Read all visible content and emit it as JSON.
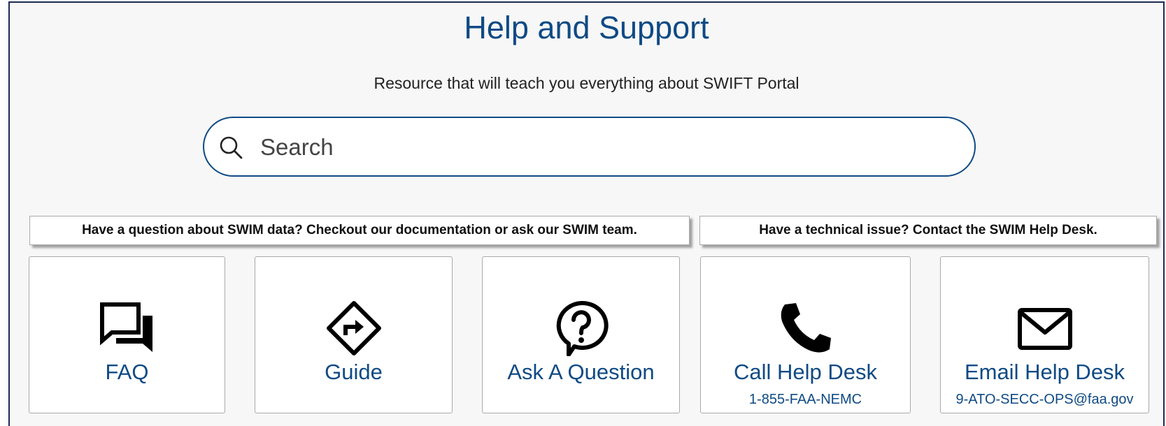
{
  "header": {
    "title": "Help and Support",
    "subtitle": "Resource that will teach you everything about SWIFT Portal"
  },
  "search": {
    "placeholder": "Search",
    "value": "",
    "icon": "search-icon"
  },
  "banners": [
    {
      "text": "Have a question about SWIM data? Checkout our documentation or ask our SWIM team."
    },
    {
      "text": "Have a technical issue? Contact the SWIM Help Desk."
    }
  ],
  "cards": [
    {
      "label": "FAQ",
      "sub": "",
      "icon": "chat-bubbles-icon"
    },
    {
      "label": "Guide",
      "sub": "",
      "icon": "directions-sign-icon"
    },
    {
      "label": "Ask A Question",
      "sub": "",
      "icon": "question-bubble-icon"
    },
    {
      "label": "Call Help Desk",
      "sub": "1-855-FAA-NEMC",
      "icon": "phone-icon"
    },
    {
      "label": "Email Help Desk",
      "sub": "9-ATO-SECC-OPS@faa.gov",
      "icon": "envelope-icon"
    }
  ],
  "colors": {
    "accent": "#0f4a84",
    "background": "#f7f7f7",
    "frame_border": "#1b2a52"
  }
}
